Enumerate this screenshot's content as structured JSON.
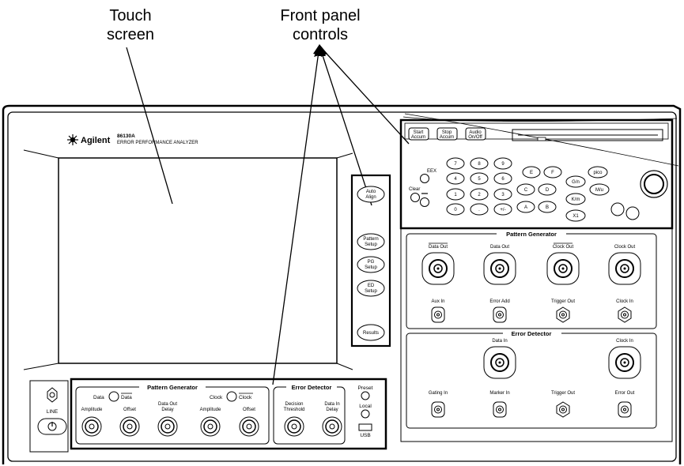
{
  "callouts": {
    "touch_screen": "Touch\nscreen",
    "front_panel": "Front panel\ncontrols"
  },
  "brand": {
    "name": "Agilent",
    "model": "86130A",
    "description": "ERROR PERFORMANCE ANALYZER"
  },
  "side_keys": {
    "auto_align": "Auto\nAlign",
    "pattern_setup": "Pattern\nSetup",
    "pg_setup": "PG\nSetup",
    "ed_setup": "ED\nSetup",
    "results": "Results"
  },
  "top_keys": {
    "start_accum": "Start\nAccum",
    "stop_accum": "Stop\nAccum",
    "audio_on_off": "Audio\nOn/Off"
  },
  "keypad": {
    "eex": "EEX",
    "clear": "Clear",
    "digits": [
      "7",
      "8",
      "9",
      "4",
      "5",
      "6",
      "1",
      "2",
      "3",
      "0",
      ".",
      "+/-"
    ],
    "hex": [
      "E",
      "F",
      "C",
      "D",
      "A",
      "B"
    ],
    "units": [
      "G/n",
      "K/m",
      "X1",
      "pico",
      "M/u"
    ]
  },
  "pattern_generator_panel": {
    "title": "Pattern Generator",
    "connectors": [
      "Data Out",
      "Data Out",
      "Clock Out",
      "Clock Out"
    ],
    "small_connectors": [
      "Aux In",
      "Error Add",
      "Trigger Out",
      "Clock In"
    ]
  },
  "error_detector_panel": {
    "title": "Error Detector",
    "connectors": [
      "Data In",
      "Clock In"
    ],
    "small_connectors": [
      "Gating In",
      "Marker In",
      "Trigger Out",
      "Error Out"
    ]
  },
  "bottom_pg": {
    "title": "Pattern Generator",
    "data_toggle": "Data",
    "data_bar": "Data",
    "clock_toggle": "Clock",
    "clock_bar": "Clock",
    "knobs": [
      "Amplitude",
      "Offset",
      "Data Out\nDelay",
      "Amplitude",
      "Offset"
    ]
  },
  "bottom_ed": {
    "title": "Error Detector",
    "knobs": [
      "Decision\nThreshold",
      "Data In\nDelay"
    ]
  },
  "misc": {
    "preset": "Preset",
    "local": "Local",
    "usb": "USB",
    "line": "LINE"
  }
}
